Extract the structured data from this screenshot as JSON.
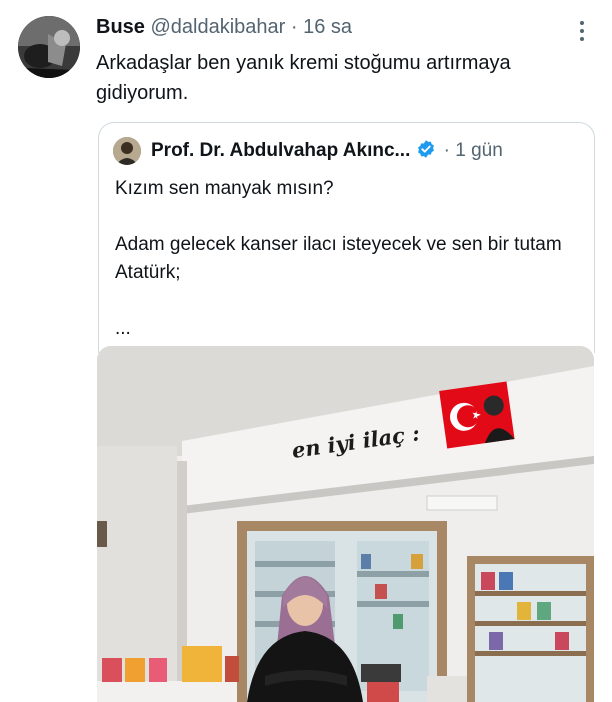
{
  "tweet": {
    "author_name": "Buse",
    "handle": "@daldakibahar",
    "separator": "·",
    "time": "16 sa",
    "text": "Arkadaşlar ben yanık kremi stoğumu artırmaya gidiyorum.",
    "more_icon": "more-vertical-icon"
  },
  "quote": {
    "author_name": "Prof. Dr. Abdulvahap Akınc...",
    "verified_badge": "verified-badge-icon",
    "badge_color": "#1d9bf0",
    "separator": "·",
    "time": "1 gün",
    "text": "Kızım sen manyak mısın?\n\nAdam gelecek kanser ilacı isteyecek ve sen bir tutam Atatürk;\n\n...",
    "image": {
      "description_icon": "pharmacy-photo",
      "sign_text": "en iyi ilaç :"
    }
  },
  "colors": {
    "secondary_text": "#536471",
    "border": "#cfd9de",
    "flag_red": "#e30a17"
  }
}
